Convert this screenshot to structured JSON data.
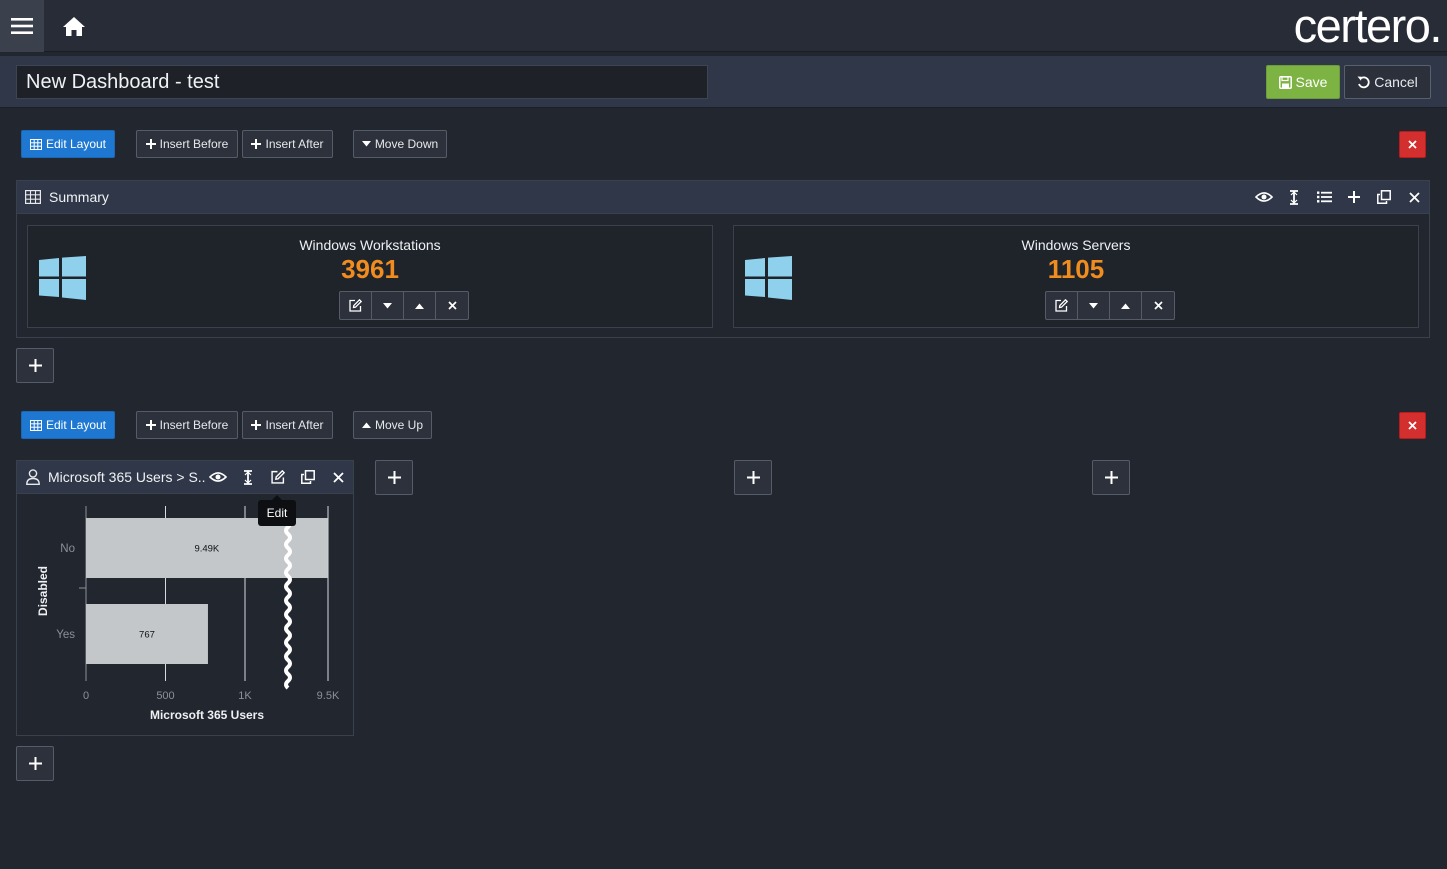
{
  "brand": {
    "logo_text": "certero."
  },
  "dashboard": {
    "title_value": "New Dashboard - test",
    "save_label": "Save",
    "cancel_label": "Cancel"
  },
  "row1": {
    "edit_layout_label": "Edit Layout",
    "insert_before_label": "Insert Before",
    "insert_after_label": "Insert After",
    "move_label": "Move Down",
    "panel": {
      "title": "Summary",
      "tiles": [
        {
          "title": "Windows Workstations",
          "value": "3961"
        },
        {
          "title": "Windows Servers",
          "value": "1105"
        }
      ]
    }
  },
  "row2": {
    "edit_layout_label": "Edit Layout",
    "insert_before_label": "Insert Before",
    "insert_after_label": "Insert After",
    "move_label": "Move Up",
    "widget": {
      "title": "Microsoft 365 Users > S..",
      "tooltip": "Edit"
    }
  },
  "colors": {
    "accent": "#1e78d2",
    "save": "#7cb342",
    "danger": "#d32f2f",
    "value": "#f08d1e",
    "windows_logo": "#8fd0ec",
    "bar": "#c4c7ca"
  },
  "icons": [
    "menu-icon",
    "home-icon",
    "save-icon",
    "undo-icon",
    "grid-icon",
    "plus-icon",
    "caret-down-icon",
    "caret-up-icon",
    "close-icon",
    "eye-icon",
    "text-cursor-icon",
    "list-icon",
    "copy-icon",
    "edit-icon",
    "user-icon",
    "windows-logo-icon"
  ],
  "chart_data": {
    "type": "bar",
    "orientation": "horizontal",
    "categories": [
      "No",
      "Yes"
    ],
    "values": [
      9490,
      767
    ],
    "data_labels": [
      "9.49K",
      "767"
    ],
    "xlabel": "Microsoft 365 Users",
    "ylabel": "Disabled",
    "x_ticks": [
      "0",
      "500",
      "1K",
      "9.5K"
    ],
    "x_tick_values": [
      0,
      500,
      1000,
      9500
    ],
    "axis_break": true,
    "grid": true
  }
}
